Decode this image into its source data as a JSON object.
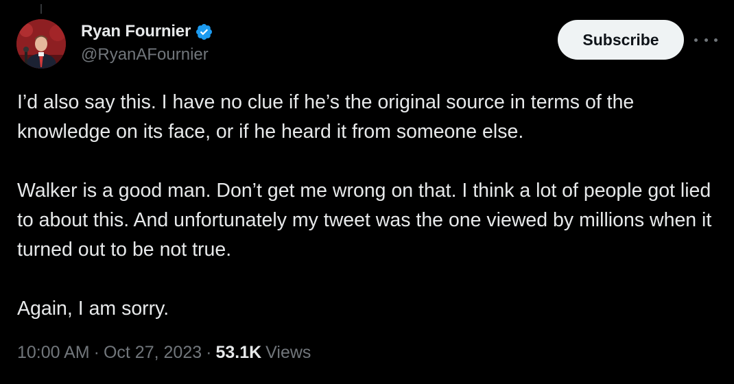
{
  "tweet": {
    "author": {
      "display_name": "Ryan Fournier",
      "handle": "@RyanAFournier",
      "verified_icon": "verified-badge-icon",
      "avatar_icon": "avatar-photo"
    },
    "subscribe_label": "Subscribe",
    "more_icon": "more-horizontal-icon",
    "paragraphs": [
      "I’d also say this. I have no clue if he’s the original source in terms of the knowledge on its face, or if he heard it from someone else.",
      "Walker is a good man. Don’t get me wrong on that. I think a lot of people got lied to about this. And unfortunately my tweet was the one viewed by millions when it turned out to be not true.",
      "Again, I am sorry."
    ],
    "meta": {
      "time": "10:00 AM",
      "separator": "·",
      "date": "Oct 27, 2023",
      "views_count": "53.1K",
      "views_label": "Views"
    }
  },
  "colors": {
    "background": "#000000",
    "text_primary": "#e7e9ea",
    "text_secondary": "#71767b",
    "verified_blue": "#1d9bf0",
    "button_bg": "#eff3f4",
    "button_text": "#0f1419"
  }
}
